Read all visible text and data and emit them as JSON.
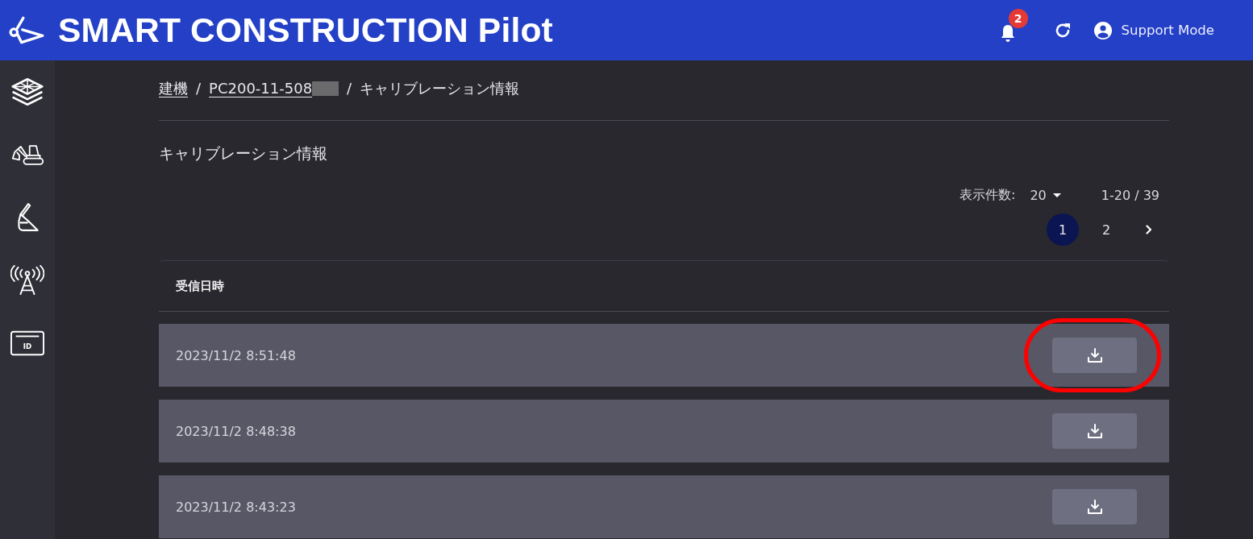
{
  "header": {
    "title": "SMART CONSTRUCTION Pilot",
    "notification_count": "2",
    "user": "Support Mode"
  },
  "sidebar": {
    "items": [
      {
        "kind": "layers"
      },
      {
        "kind": "excavator"
      },
      {
        "kind": "bucket"
      },
      {
        "kind": "antenna"
      },
      {
        "kind": "id-card",
        "label": "ID"
      }
    ]
  },
  "breadcrumb": [
    {
      "label": "建機",
      "link": true,
      "redacted": false
    },
    {
      "separator": "/",
      "label": "PC200-11-508",
      "link": true,
      "redacted": true
    },
    {
      "separator": "/",
      "label": "キャリブレーション情報",
      "link": false,
      "redacted": false
    }
  ],
  "page_title": "キャリブレーション情報",
  "pagination": {
    "per_page_label": "表示件数:",
    "per_page": "20",
    "range": "1-20 / 39",
    "pages": [
      {
        "label": "1",
        "selected": true
      },
      {
        "label": "2",
        "selected": false
      }
    ]
  },
  "table": {
    "columns": [
      "受信日時"
    ],
    "rows": [
      {
        "received_at": "2023/11/2 8:51:48",
        "highlighted": true
      },
      {
        "received_at": "2023/11/2 8:48:38",
        "highlighted": false
      },
      {
        "received_at": "2023/11/2 8:43:23",
        "highlighted": false
      }
    ]
  }
}
